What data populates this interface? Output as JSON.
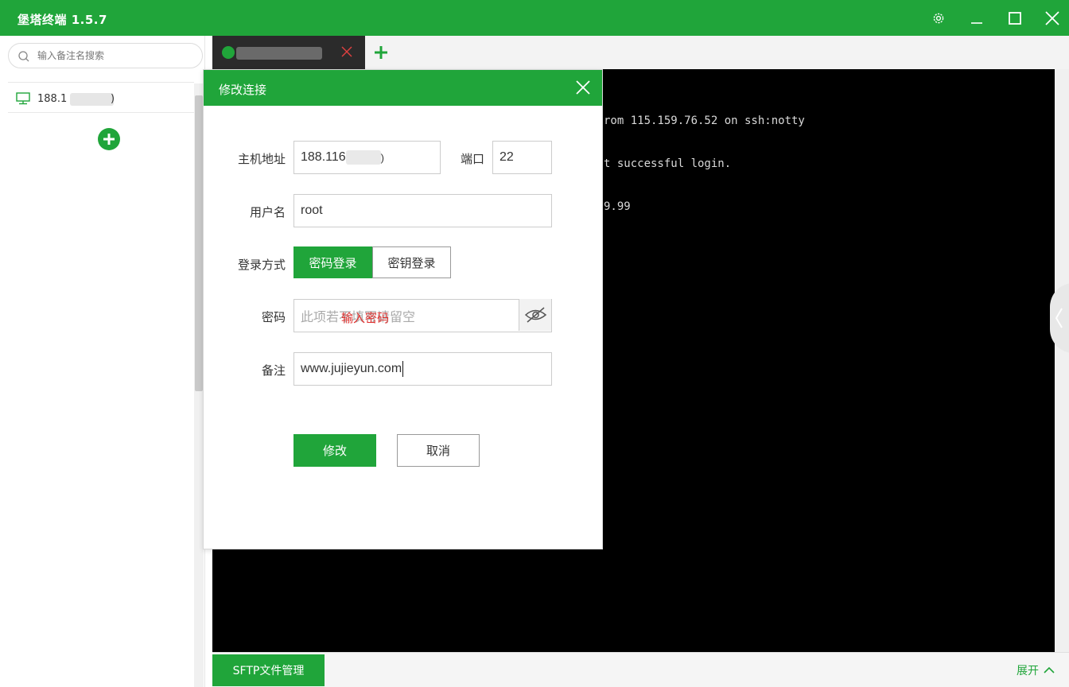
{
  "app": {
    "title": "堡塔终端 1.5.7"
  },
  "window_controls": [
    "gear-icon",
    "minimize-icon",
    "maximize-icon",
    "close-icon"
  ],
  "sidebar": {
    "search": {
      "placeholder": "输入备注名搜索",
      "value": ""
    },
    "hosts": [
      {
        "label": "188.1",
        "suffix": ")"
      }
    ]
  },
  "tabs": [
    {
      "label": "",
      "status": "connected"
    }
  ],
  "terminal": {
    "lines": [
      "rom 115.159.76.52 on ssh:notty",
      "t successful login.",
      "9.99"
    ]
  },
  "bottom": {
    "sftp_label": "SFTP文件管理",
    "expand_label": "展开"
  },
  "modal": {
    "title": "修改连接",
    "host_label": "主机地址",
    "host_value": "188.116",
    "host_suffix": ")",
    "port_label": "端口",
    "port_value": "22",
    "user_label": "用户名",
    "user_value": "root",
    "login_label": "登录方式",
    "login_options": [
      "密码登录",
      "密钥登录"
    ],
    "login_selected": "密码登录",
    "password_label": "密码",
    "password_placeholder": "此项若不填写请留空",
    "password_hint": "输入密码",
    "note_label": "备注",
    "note_value": "www.jujieyun.com",
    "submit_label": "修改",
    "cancel_label": "取消"
  },
  "colors": {
    "accent": "#20a53a",
    "terminal_bg": "#000000",
    "hint_red": "#e0302e"
  }
}
